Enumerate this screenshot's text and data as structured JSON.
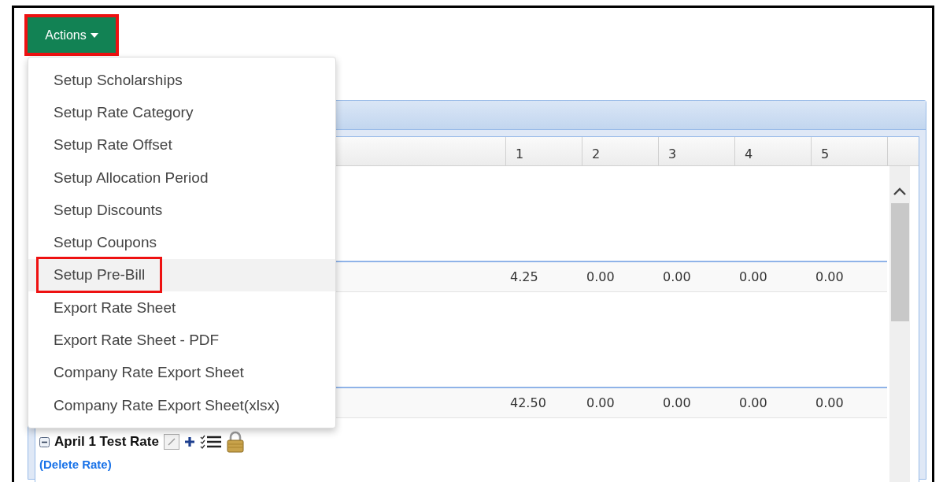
{
  "actions_button": {
    "label": "Actions",
    "highlighted": true
  },
  "actions_menu": [
    {
      "label": "Setup Scholarships",
      "highlighted": false
    },
    {
      "label": "Setup Rate Category",
      "highlighted": false
    },
    {
      "label": "Setup Rate Offset",
      "highlighted": false
    },
    {
      "label": "Setup Allocation Period",
      "highlighted": false
    },
    {
      "label": "Setup Discounts",
      "highlighted": false
    },
    {
      "label": "Setup Coupons",
      "highlighted": false
    },
    {
      "label": "Setup Pre-Bill",
      "highlighted": true
    },
    {
      "label": "Export Rate Sheet",
      "highlighted": false
    },
    {
      "label": "Export Rate Sheet - PDF",
      "highlighted": false
    },
    {
      "label": "Company Rate Export Sheet",
      "highlighted": false
    },
    {
      "label": "Company Rate Export Sheet(xlsx)",
      "highlighted": false
    }
  ],
  "table": {
    "columns": [
      "1",
      "2",
      "3",
      "4",
      "5"
    ],
    "rows": [
      [
        "4.25",
        "0.00",
        "0.00",
        "0.00",
        "0.00"
      ],
      [
        "42.50",
        "0.00",
        "0.00",
        "0.00",
        "0.00"
      ]
    ]
  },
  "rate": {
    "name": "April 1 Test Rate",
    "expanded": true,
    "delete_link": "(Delete Rate)"
  }
}
